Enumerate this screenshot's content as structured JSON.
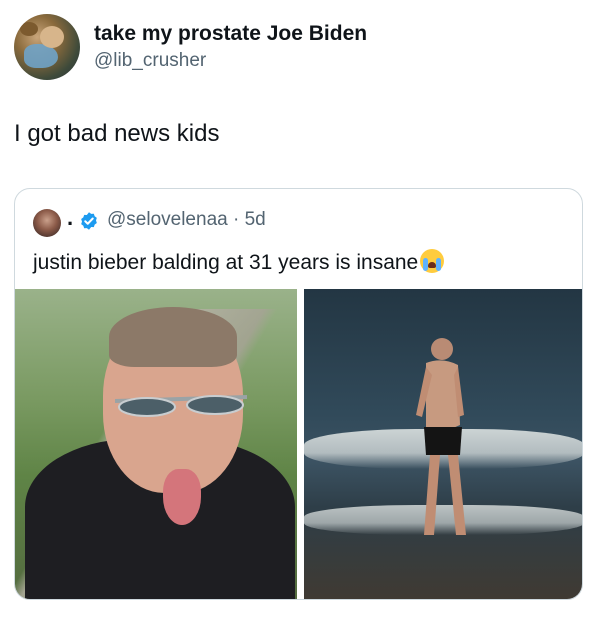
{
  "tweet": {
    "display_name": "take my prostate Joe Biden",
    "handle": "@lib_crusher",
    "text": "I got bad news kids"
  },
  "quoted_tweet": {
    "display_name": ".",
    "handle_and_time": "@selovelenaa · 5d",
    "text": "justin bieber balding at 31 years is insane",
    "emoji": "loudly-crying-face",
    "verified": true
  },
  "colors": {
    "text": "#0f1419",
    "secondary": "#536471",
    "verified": "#1d9bf0",
    "border": "#cfd9de"
  }
}
